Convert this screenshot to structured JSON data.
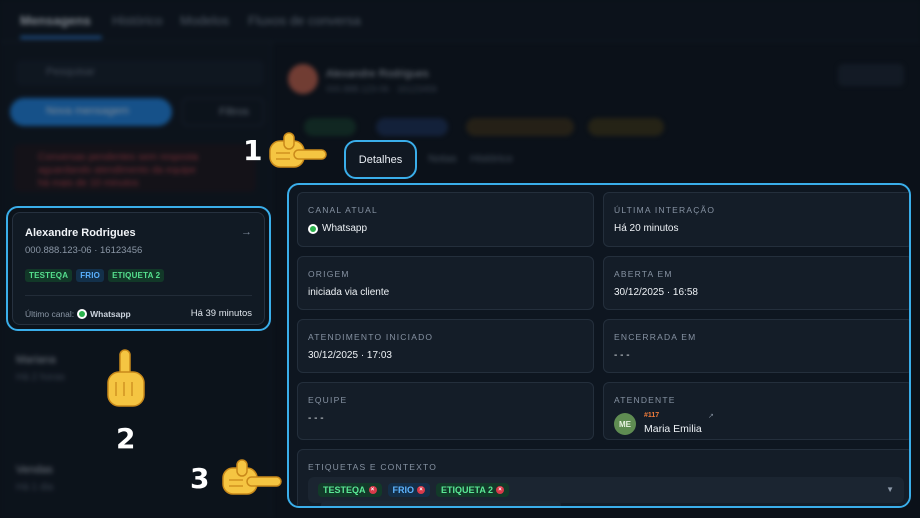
{
  "background": {
    "top_tabs": [
      "Mensagens",
      "Histórico",
      "Modelos",
      "Fluxos de conversa"
    ],
    "search_placeholder": "Pesquisar",
    "new_message_label": "Nova mensagem",
    "filter_label": "Filtros",
    "alert_lines": [
      "Conversas pendentes sem resposta",
      "aguardando atendimento da equipe",
      "há mais de 10 minutos"
    ],
    "sidebar_items": [
      {
        "name": "Mariana",
        "sub": "Há 2 horas"
      },
      {
        "name": "Vendas",
        "sub": "Há 1 dia"
      }
    ],
    "contact_name": "Alexandre Rodrigues",
    "contact_sub": "000.888.123-06 · 16123456",
    "close_label": "Encerrar",
    "subtabs": [
      "Notas",
      "Histórico"
    ]
  },
  "conversation_card": {
    "name": "Alexandre Rodrigues",
    "document": "000.888.123-06 · 16123456",
    "tags": [
      {
        "label": "TESTEQA",
        "color": "green"
      },
      {
        "label": "FRIO",
        "color": "blue"
      },
      {
        "label": "ETIQUETA 2",
        "color": "green"
      }
    ],
    "last_channel_label": "Último canal:",
    "last_channel": "Whatsapp",
    "time": "Há 39 minutos"
  },
  "details_tab": {
    "label": "Detalhes"
  },
  "details": {
    "canal_atual": {
      "label": "CANAL ATUAL",
      "value": "Whatsapp"
    },
    "ultima_interacao": {
      "label": "ÚLTIMA INTERAÇÃO",
      "value": "Há 20 minutos"
    },
    "origem": {
      "label": "ORIGEM",
      "value": "iniciada via cliente"
    },
    "aberta_em": {
      "label": "ABERTA EM",
      "value": "30/12/2025 · 16:58"
    },
    "atendimento_iniciado": {
      "label": "ATENDIMENTO INICIADO",
      "value": "30/12/2025 · 17:03"
    },
    "encerrada_em": {
      "label": "ENCERRADA EM",
      "value": "- - -"
    },
    "equipe": {
      "label": "EQUIPE",
      "value": "- - -"
    },
    "atendente": {
      "label": "ATENDENTE",
      "initials": "ME",
      "id": "#117",
      "name": "Maria Emilia"
    },
    "etiquetas": {
      "label": "ETIQUETAS E CONTEXTO",
      "tags": [
        {
          "label": "TESTEQA",
          "color": "green"
        },
        {
          "label": "FRIO",
          "color": "blue"
        },
        {
          "label": "ETIQUETA 2",
          "color": "green"
        }
      ]
    }
  },
  "annotations": {
    "one": "1",
    "two": "2",
    "three": "3"
  },
  "colors": {
    "highlight": "#3aaeea",
    "accent": "#1f86e6",
    "tag_green": "#55e08e",
    "tag_blue": "#5ab1ff",
    "agent_id": "#ef7b3b"
  }
}
